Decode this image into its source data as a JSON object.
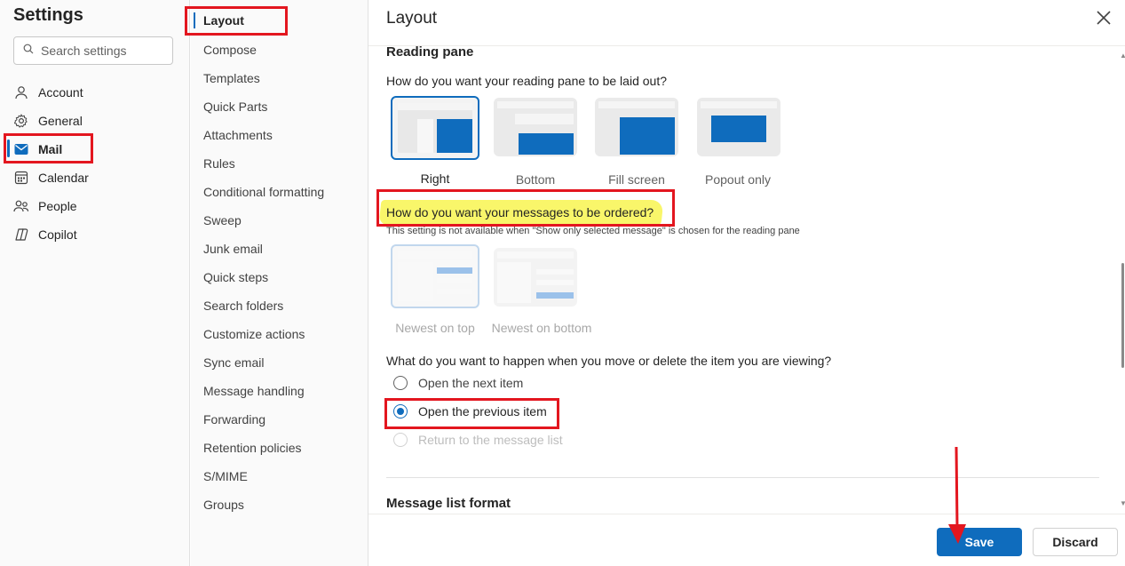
{
  "nav": {
    "title": "Settings",
    "search_placeholder": "Search settings",
    "items": [
      {
        "label": "Account",
        "icon": "person-icon"
      },
      {
        "label": "General",
        "icon": "gear-icon"
      },
      {
        "label": "Mail",
        "icon": "mail-icon",
        "selected": true
      },
      {
        "label": "Calendar",
        "icon": "calendar-icon"
      },
      {
        "label": "People",
        "icon": "people-icon"
      },
      {
        "label": "Copilot",
        "icon": "copilot-icon"
      }
    ]
  },
  "subnav": {
    "items": [
      {
        "label": "Layout",
        "selected": true
      },
      {
        "label": "Compose"
      },
      {
        "label": "Templates"
      },
      {
        "label": "Quick Parts"
      },
      {
        "label": "Attachments"
      },
      {
        "label": "Rules"
      },
      {
        "label": "Conditional formatting"
      },
      {
        "label": "Sweep"
      },
      {
        "label": "Junk email"
      },
      {
        "label": "Quick steps"
      },
      {
        "label": "Search folders"
      },
      {
        "label": "Customize actions"
      },
      {
        "label": "Sync email"
      },
      {
        "label": "Message handling"
      },
      {
        "label": "Forwarding"
      },
      {
        "label": "Retention policies"
      },
      {
        "label": "S/MIME"
      },
      {
        "label": "Groups"
      }
    ]
  },
  "panel": {
    "title": "Layout",
    "reading_pane": {
      "title": "Reading pane",
      "question": "How do you want your reading pane to be laid out?",
      "options": [
        {
          "label": "Right",
          "selected": true
        },
        {
          "label": "Bottom"
        },
        {
          "label": "Fill screen"
        },
        {
          "label": "Popout only"
        }
      ]
    },
    "ordering": {
      "question": "How do you want your messages to be ordered?",
      "note": "This setting is not available when \"Show only selected message\" is chosen for the reading pane",
      "options": [
        {
          "label": "Newest on top",
          "selected": true
        },
        {
          "label": "Newest on bottom"
        }
      ]
    },
    "move_delete": {
      "question": "What do you want to happen when you move or delete the item you are viewing?",
      "options": [
        {
          "label": "Open the next item",
          "checked": false
        },
        {
          "label": "Open the previous item",
          "checked": true
        },
        {
          "label": "Return to the message list",
          "checked": false,
          "disabled": true
        }
      ]
    },
    "next_section_title": "Message list format"
  },
  "footer": {
    "save_label": "Save",
    "discard_label": "Discard"
  },
  "colors": {
    "accent": "#0f6cbd",
    "annotation_red": "#e3161f",
    "highlight_yellow": "#f9f66a"
  }
}
